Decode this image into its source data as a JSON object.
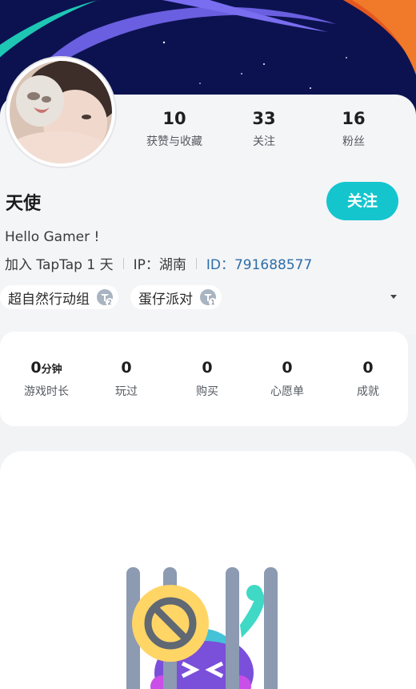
{
  "profile": {
    "username": "天使",
    "bio": "Hello Gamer !",
    "joined": "加入 TapTap 1 天",
    "ip": "IP：湖南",
    "user_id": "ID：791688577",
    "follow_label": "关注"
  },
  "stats": [
    {
      "value": "10",
      "label": "获赞与收藏"
    },
    {
      "value": "33",
      "label": "关注"
    },
    {
      "value": "16",
      "label": "粉丝"
    }
  ],
  "tags": [
    {
      "label": "超自然行动组",
      "badge_level": "2"
    },
    {
      "label": "蛋仔派对",
      "badge_level": "1"
    }
  ],
  "game_stats": {
    "playtime_value": "0",
    "playtime_unit": "分钟",
    "playtime_label": "游戏时长",
    "played_value": "0",
    "played_label": "玩过",
    "bought_value": "0",
    "bought_label": "购买",
    "wishlist_value": "0",
    "wishlist_label": "心愿单",
    "achievements_value": "0",
    "achievements_label": "成就"
  },
  "colors": {
    "accent": "#15c5ce",
    "banner": "#0c1250",
    "id_link": "#2d6ea8"
  },
  "icons": {
    "badge": "tap-level-badge-icon",
    "caret": "dropdown-caret-icon",
    "empty_state": "no-content-cage-illustration"
  }
}
